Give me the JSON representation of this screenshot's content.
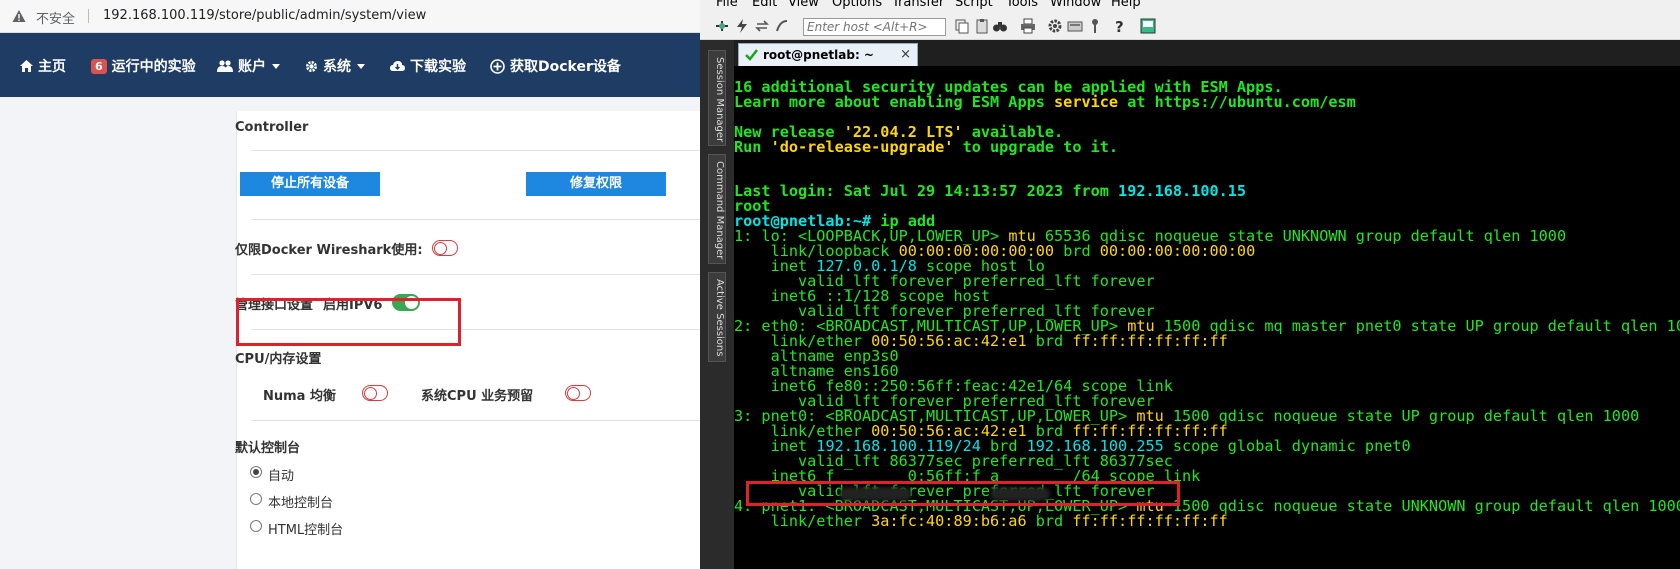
{
  "browser": {
    "insecure_label": "不安全",
    "url": "192.168.100.119/store/public/admin/system/view",
    "nav": {
      "home": "主页",
      "running_badge": "6",
      "running": "运行中的实验",
      "accounts": "账户",
      "system": "系统",
      "download": "下载实验",
      "docker": "获取Docker设备"
    },
    "panel": {
      "controller_title": "Controller",
      "stop_all": "停止所有设备",
      "fix_perms": "修复权限",
      "docker_wireshark": "仅限Docker Wireshark使用:",
      "mgmt_iface": "管理接口设置",
      "enable_ipv6": "启用IPV6",
      "cpu_mem_title": "CPU/内存设置",
      "numa": "Numa 均衡",
      "cpu_reserve": "系统CPU 业务预留",
      "default_console_title": "默认控制台",
      "console_auto": "自动",
      "console_local": "本地控制台",
      "console_html": "HTML控制台"
    }
  },
  "crt": {
    "menu": [
      "File",
      "Edit",
      "View",
      "Options",
      "Transfer",
      "Script",
      "Tools",
      "Window",
      "Help"
    ],
    "host_placeholder": "Enter host <Alt+R>",
    "side_tabs": [
      "Session Manager",
      "Command Manager",
      "Active Sessions"
    ],
    "session_tab": "root@pnetlab: ~",
    "terminal": {
      "l1": "16 additional security updates can be applied with ESM Apps.",
      "l2a": "Learn more about enabling ESM Apps ",
      "l2b": "service",
      "l2c": " at https://ubuntu.com/esm",
      "l3a": "New release ",
      "l3b": "'22.04.2 LTS'",
      "l3c": " available.",
      "l4a": "Run ",
      "l4b": "'do-release-upgrade'",
      "l4c": " to upgrade to it.",
      "l5a": "Last login: Sat Jul 29 14:13:57 2023 from ",
      "l5b": "192.168.100.15",
      "l6": "root",
      "l7a": "root@pnetlab:~#",
      "l7b": " ip add",
      "l8a": "1: lo: <LOOPBACK,UP,LOWER_UP> ",
      "l8b": "mtu",
      "l8c": " 65536 qdisc noqueue state UNKNOWN group default qlen 1000",
      "l9a": "    link/loopback ",
      "l9b": "00:00:00:00:00:00",
      "l9c": " brd ",
      "l9d": "00:00:00:00:00:00",
      "l10a": "    inet ",
      "l10b": "127.0.0.1/8",
      "l10c": " scope host lo",
      "l11": "       valid_lft forever preferred_lft forever",
      "l12": "    inet6 ::1/128 scope host",
      "l13": "       valid_lft forever preferred_lft forever",
      "l14a": "2: eth0: <BROADCAST,MULTICAST,UP,LOWER_UP> ",
      "l14b": "mtu",
      "l14c": " 1500 qdisc mq master pnet0 state UP group default qlen 1000",
      "l15a": "    link/ether ",
      "l15b": "00:50:56:ac:42:e1",
      "l15c": " brd ",
      "l15d": "ff:ff:ff:ff:ff:ff",
      "l16": "    altname enp3s0",
      "l17": "    altname ens160",
      "l18": "    inet6 fe80::250:56ff:feac:42e1/64 scope link",
      "l19": "       valid_lft forever preferred_lft forever",
      "l20a": "3: pnet0: <BROADCAST,MULTICAST,UP,LOWER_UP> ",
      "l20b": "mtu",
      "l20c": " 1500 qdisc noqueue state UP group default qlen 1000",
      "l21a": "    link/ether ",
      "l21b": "00:50:56:ac:42:e1",
      "l21c": " brd ",
      "l21d": "ff:ff:ff:ff:ff:ff",
      "l22a": "    inet ",
      "l22b": "192.168.100.119/24",
      "l22c": " brd ",
      "l22d": "192.168.100.255",
      "l22e": " scope global dynamic pnet0",
      "l23": "       valid_lft 86377sec preferred_lft 86377sec",
      "l24": "    inet6 f        0:56ff:f a        /64 scope link",
      "l25": "       valid_lft forever preferred_lft forever",
      "l26a": "4: pnet1: <BROADCAST,MULTICAST,UP,LOWER_UP> ",
      "l26b": "mtu",
      "l26c": " 1500 qdisc noqueue state UNKNOWN group default qlen 1000",
      "l27a": "    link/ether ",
      "l27b": "3a:fc:40:89:b6:a6",
      "l27c": " brd ",
      "l27d": "ff:ff:ff:ff:ff:ff"
    }
  },
  "colors": {
    "navbar": "#1e3c64",
    "button_blue": "#1e87e0",
    "toggle_on": "#3aa853",
    "toggle_off": "#e0393e",
    "highlight": "#e0202a",
    "term_green": "#1ee81e",
    "term_yellow": "#ffd700"
  }
}
